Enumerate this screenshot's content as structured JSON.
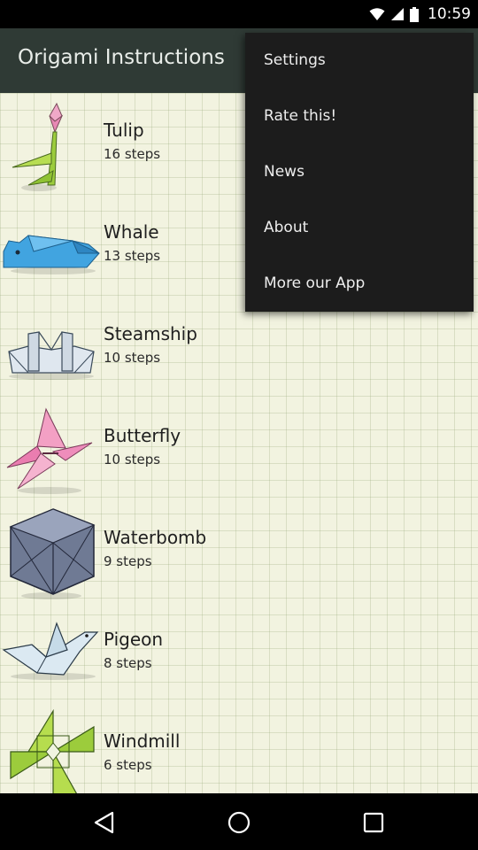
{
  "status_bar": {
    "time": "10:59"
  },
  "app_bar": {
    "title": "Origami Instructions"
  },
  "items": [
    {
      "name": "Tulip",
      "steps": "16 steps"
    },
    {
      "name": "Whale",
      "steps": "13 steps"
    },
    {
      "name": "Steamship",
      "steps": "10 steps"
    },
    {
      "name": "Butterfly",
      "steps": "10 steps"
    },
    {
      "name": "Waterbomb",
      "steps": "9 steps"
    },
    {
      "name": "Pigeon",
      "steps": "8 steps"
    },
    {
      "name": "Windmill",
      "steps": "6 steps"
    }
  ],
  "menu": {
    "items": [
      {
        "label": "Settings"
      },
      {
        "label": "Rate this!"
      },
      {
        "label": "News"
      },
      {
        "label": "About"
      },
      {
        "label": "More our App"
      }
    ]
  },
  "nav": {
    "back_icon": "back-triangle-icon",
    "home_icon": "home-circle-icon",
    "recents_icon": "recents-square-icon"
  },
  "colors": {
    "app_bar": "#2f3a35",
    "menu_bg": "#1c1c1c",
    "paper": "#f2f3e0"
  }
}
